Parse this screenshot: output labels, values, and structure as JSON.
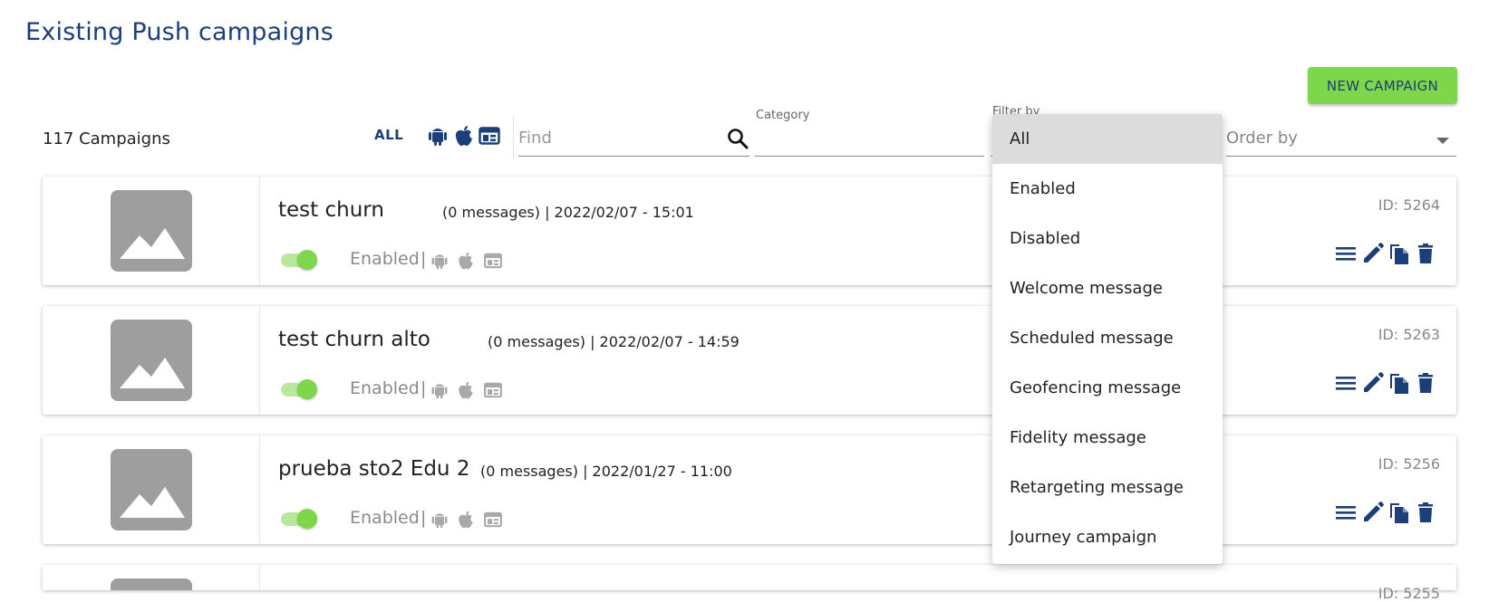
{
  "header": {
    "title": "Existing Push campaigns",
    "new_campaign_label": "NEW CAMPAIGN"
  },
  "toolbar": {
    "count_text": "117 Campaigns",
    "all_label": "ALL",
    "platform_icons": [
      "android-icon",
      "apple-icon",
      "web-icon"
    ],
    "find_placeholder": "Find",
    "category_label": "Category",
    "filter_label": "Filter by",
    "order_placeholder": "Order by"
  },
  "filter_dropdown": {
    "options": [
      "All",
      "Enabled",
      "Disabled",
      "Welcome message",
      "Scheduled message",
      "Geofencing message",
      "Fidelity message",
      "Retargeting message",
      "Journey campaign"
    ],
    "selected": "All"
  },
  "campaigns": [
    {
      "title": "test churn",
      "meta": "(0 messages) | 2022/02/07 - 15:01",
      "status": "Enabled",
      "separator": "|",
      "id": "ID: 5264",
      "enabled": true
    },
    {
      "title": "test churn alto",
      "meta": "(0 messages) | 2022/02/07 - 14:59",
      "status": "Enabled",
      "separator": "|",
      "id": "ID: 5263",
      "enabled": true
    },
    {
      "title": "prueba sto2 Edu 2",
      "meta": "(0 messages) | 2022/01/27 - 11:00",
      "status": "Enabled",
      "separator": "|",
      "id": "ID: 5256",
      "enabled": true
    },
    {
      "title": "",
      "meta": "",
      "status": "",
      "separator": "",
      "id": "ID: 5255",
      "enabled": true
    }
  ],
  "colors": {
    "title_blue": "#1c3f7a",
    "accent_green": "#7ed64a",
    "icon_grey": "#a9a9a9",
    "thumb_grey": "#9e9e9e"
  }
}
